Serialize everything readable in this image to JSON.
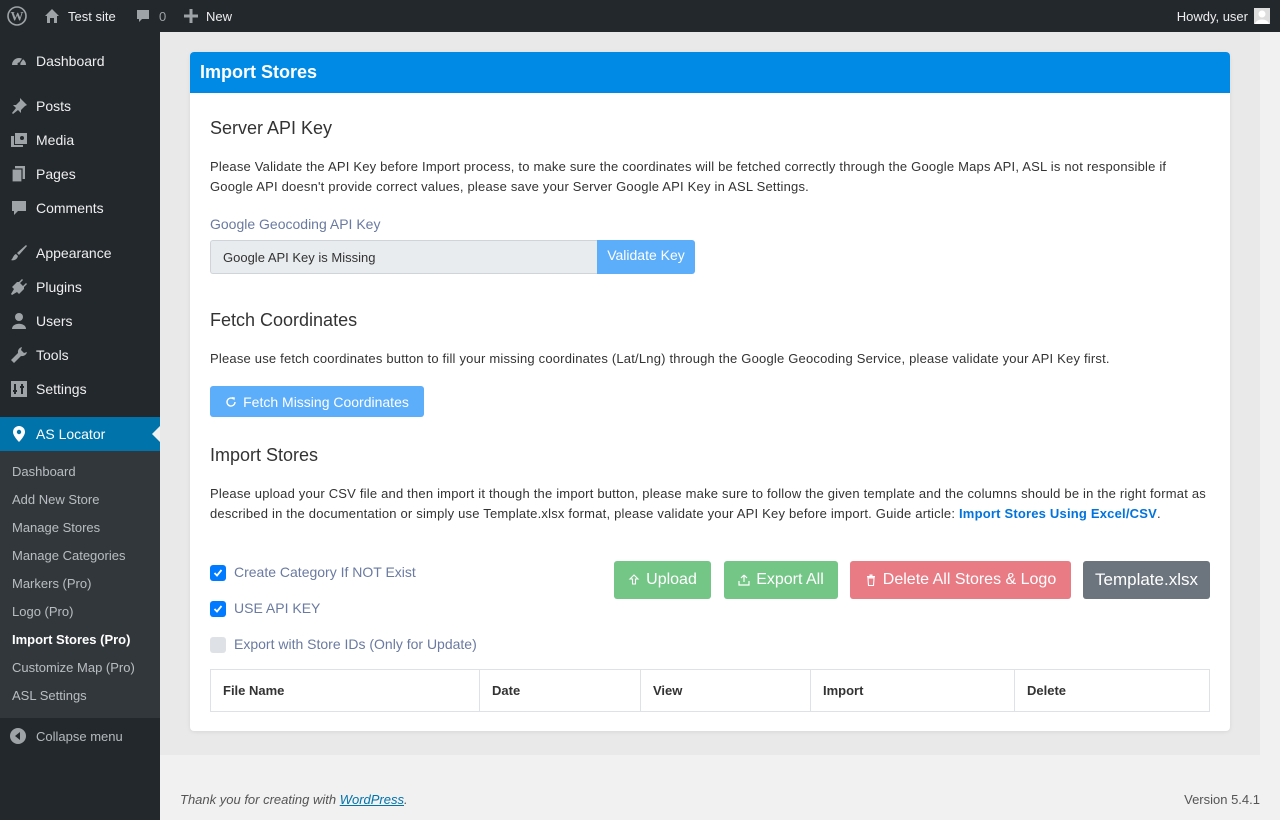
{
  "adminbar": {
    "site_name": "Test site",
    "comments_count": "0",
    "new_label": "New",
    "howdy": "Howdy, user"
  },
  "sidebar": {
    "items": [
      {
        "label": "Dashboard",
        "icon": "dashboard-icon"
      },
      {
        "label": "Posts",
        "icon": "pin-icon"
      },
      {
        "label": "Media",
        "icon": "media-icon"
      },
      {
        "label": "Pages",
        "icon": "pages-icon"
      },
      {
        "label": "Comments",
        "icon": "comment-icon"
      },
      {
        "label": "Appearance",
        "icon": "brush-icon"
      },
      {
        "label": "Plugins",
        "icon": "plugin-icon"
      },
      {
        "label": "Users",
        "icon": "user-icon"
      },
      {
        "label": "Tools",
        "icon": "wrench-icon"
      },
      {
        "label": "Settings",
        "icon": "settings-icon"
      },
      {
        "label": "AS Locator",
        "icon": "location-pin-icon"
      }
    ],
    "submenu": [
      "Dashboard",
      "Add New Store",
      "Manage Stores",
      "Manage Categories",
      "Markers (Pro)",
      "Logo (Pro)",
      "Import Stores (Pro)",
      "Customize Map (Pro)",
      "ASL Settings"
    ],
    "collapse_label": "Collapse menu"
  },
  "card": {
    "title": "Import Stores",
    "server_api": {
      "heading": "Server API Key",
      "text": "Please Validate the API Key before Import process, to make sure the coordinates will be fetched correctly through the Google Maps API, ASL is not responsible if Google API doesn't provide correct values, please save your Server Google API Key in ASL Settings.",
      "field_label": "Google Geocoding API Key",
      "field_value": "Google API Key is Missing",
      "validate_label": "Validate Key"
    },
    "fetch": {
      "heading": "Fetch Coordinates",
      "text": "Please use fetch coordinates button to fill your missing coordinates (Lat/Lng) through the Google Geocoding Service, please validate your API Key first.",
      "button_label": "Fetch Missing Coordinates"
    },
    "import": {
      "heading": "Import Stores",
      "text": "Please upload your CSV file and then import it though the import button, please make sure to follow the given template and the columns should be in the right format as described in the documentation or simply use Template.xlsx format, please validate your API Key before import. Guide article:",
      "link_text": "Import Stores Using Excel/CSV",
      "text_end": ".",
      "checkboxes": [
        {
          "label": "Create Category If NOT Exist",
          "checked": true
        },
        {
          "label": "USE API KEY",
          "checked": true
        },
        {
          "label": "Export with Store IDs (Only for Update)",
          "checked": false
        }
      ],
      "buttons": {
        "upload": "Upload",
        "export_all": "Export All",
        "delete_all": "Delete All Stores & Logo",
        "template": "Template.xlsx"
      },
      "table_headers": [
        "File Name",
        "Date",
        "View",
        "Import",
        "Delete"
      ]
    }
  },
  "footer": {
    "thanks_prefix": "Thank you for creating with",
    "wp_link": "WordPress",
    "thanks_suffix": ".",
    "version": "Version 5.4.1"
  },
  "colors": {
    "adminbar": "#23282d",
    "primary": "#008ae6",
    "success": "#74c686",
    "danger": "#e97b85",
    "secondary": "#6c757d",
    "light_blue": "#5cadfa"
  }
}
